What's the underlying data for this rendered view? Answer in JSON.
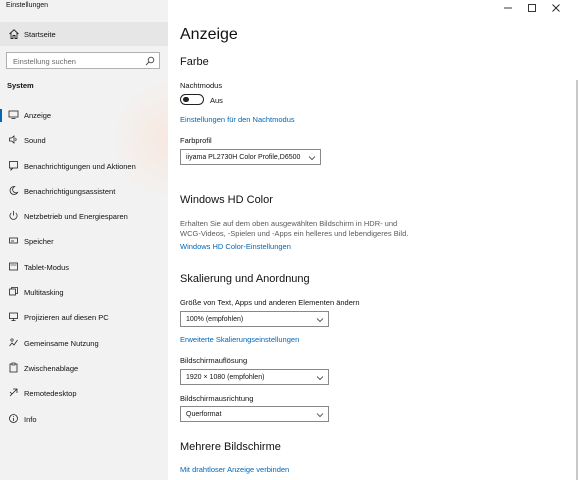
{
  "window": {
    "title": "Einstellungen"
  },
  "sidebar": {
    "home_label": "Startseite",
    "search_placeholder": "Einstellung suchen",
    "section_label": "System",
    "items": [
      {
        "label": "Anzeige",
        "icon": "display-icon",
        "selected": true
      },
      {
        "label": "Sound",
        "icon": "speaker-icon"
      },
      {
        "label": "Benachrichtigungen und Aktionen",
        "icon": "notification-icon"
      },
      {
        "label": "Benachrichtigungsassistent",
        "icon": "moon-icon"
      },
      {
        "label": "Netzbetrieb und Energiesparen",
        "icon": "power-icon"
      },
      {
        "label": "Speicher",
        "icon": "storage-icon"
      },
      {
        "label": "Tablet-Modus",
        "icon": "tablet-icon"
      },
      {
        "label": "Multitasking",
        "icon": "multitasking-icon"
      },
      {
        "label": "Projizieren auf diesen PC",
        "icon": "project-icon"
      },
      {
        "label": "Gemeinsame Nutzung",
        "icon": "shared-icon"
      },
      {
        "label": "Zwischenablage",
        "icon": "clipboard-icon"
      },
      {
        "label": "Remotedesktop",
        "icon": "remote-icon"
      },
      {
        "label": "Info",
        "icon": "info-icon"
      }
    ]
  },
  "main": {
    "page_title": "Anzeige",
    "farbe": {
      "heading": "Farbe",
      "night_label": "Nachtmodus",
      "night_state": "Aus",
      "night_link": "Einstellungen für den Nachtmodus",
      "profile_label": "Farbprofil",
      "profile_value": "iiyama PL2730H Color Profile,D6500"
    },
    "hd_color": {
      "heading": "Windows HD Color",
      "description": "Erhalten Sie auf dem oben ausgewählten Bildschirm in HDR- und WCG-Videos, -Spielen und -Apps ein helleres und lebendigeres Bild.",
      "link": "Windows HD Color-Einstellungen"
    },
    "scaling": {
      "heading": "Skalierung und Anordnung",
      "size_label": "Größe von Text, Apps und anderen Elementen ändern",
      "size_value": "100% (empfohlen)",
      "advanced_link": "Erweiterte Skalierungseinstellungen",
      "resolution_label": "Bildschirmauflösung",
      "resolution_value": "1920 × 1080 (empfohlen)",
      "orientation_label": "Bildschirmausrichtung",
      "orientation_value": "Querformat"
    },
    "multi": {
      "heading": "Mehrere Bildschirme",
      "link": "Mit drahtloser Anzeige verbinden"
    }
  },
  "colors": {
    "accent": "#0067b8",
    "sidebar_bg": "#f2f2f2",
    "selected_bg": "#e6e6e6"
  }
}
